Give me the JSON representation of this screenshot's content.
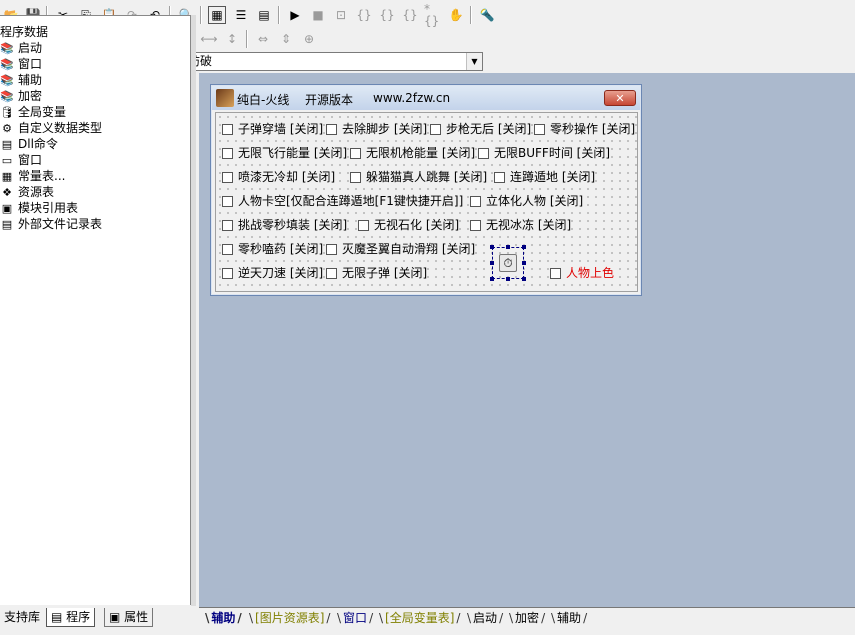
{
  "toolbar1": {
    "buttons": [
      "open-icon",
      "save-icon",
      "cut-icon",
      "copy-icon",
      "paste-icon",
      "redo-icon",
      "undo-icon",
      "find-icon",
      "layout1-icon",
      "layout2-icon",
      "layout3-icon",
      "run-icon",
      "stop-icon",
      "step-icon",
      "step-into-icon",
      "step-over-icon",
      "step-out-icon",
      "hand-icon",
      "debug-icon"
    ]
  },
  "combos": {
    "left_value": "助 *",
    "right_value": "防破"
  },
  "tree": {
    "root": "程序数据",
    "items": [
      {
        "label": "启动",
        "icon": "📚"
      },
      {
        "label": "窗口",
        "icon": "📚"
      },
      {
        "label": "辅助",
        "icon": "📚"
      },
      {
        "label": "加密",
        "icon": "📚"
      },
      {
        "label": "全局变量",
        "icon": "🛢"
      },
      {
        "label": "自定义数据类型",
        "icon": "⚙"
      },
      {
        "label": "Dll命令",
        "icon": "▤"
      },
      {
        "label": "窗口",
        "icon": "▭"
      },
      {
        "label": "常量表...",
        "icon": "▦"
      },
      {
        "label": "资源表",
        "icon": "❖"
      },
      {
        "label": "模块引用表",
        "icon": "▣"
      },
      {
        "label": "外部文件记录表",
        "icon": "▤"
      }
    ]
  },
  "form": {
    "title_app": "纯白-火线",
    "title_ver": "开源版本",
    "title_url": "www.2fzw.cn",
    "close_label": "✕",
    "checkboxes": [
      {
        "label": "子弹穿墙 [关闭]"
      },
      {
        "label": "去除脚步 [关闭]"
      },
      {
        "label": "步枪无后 [关闭]"
      },
      {
        "label": "零秒操作 [关闭]"
      },
      {
        "label": "无限飞行能量 [关闭]"
      },
      {
        "label": "无限机枪能量 [关闭]"
      },
      {
        "label": "无限BUFF时间 [关闭]"
      },
      {
        "label": "喷漆无冷却 [关闭]"
      },
      {
        "label": "躲猫猫真人跳舞 [关闭]"
      },
      {
        "label": "连蹲遁地 [关闭]"
      },
      {
        "label": "人物卡空[仅配合连蹲遁地[F1键快捷开启]]"
      },
      {
        "label": "立体化人物 [关闭]"
      },
      {
        "label": "挑战零秒填装 [关闭]"
      },
      {
        "label": "无视石化 [关闭]"
      },
      {
        "label": "无视冰冻 [关闭]"
      },
      {
        "label": "零秒嗑药 [关闭]"
      },
      {
        "label": "灭魔圣翼自动滑翔 [关闭]"
      },
      {
        "label": "逆天刀速 [关闭]"
      },
      {
        "label": "无限子弹 [关闭]"
      },
      {
        "label": "人物上色"
      }
    ],
    "red_color": "#e00000"
  },
  "left_tabs": [
    "支持库",
    "程序",
    "属性"
  ],
  "bottom_tabs": [
    "辅助",
    "[图片资源表]",
    "窗口",
    "[全局变量表]",
    "启动",
    "加密",
    "辅助"
  ],
  "colors": {
    "mdi_bg": "#abb9cd",
    "tab_blue": "#000080",
    "tab_olive": "#808000"
  }
}
